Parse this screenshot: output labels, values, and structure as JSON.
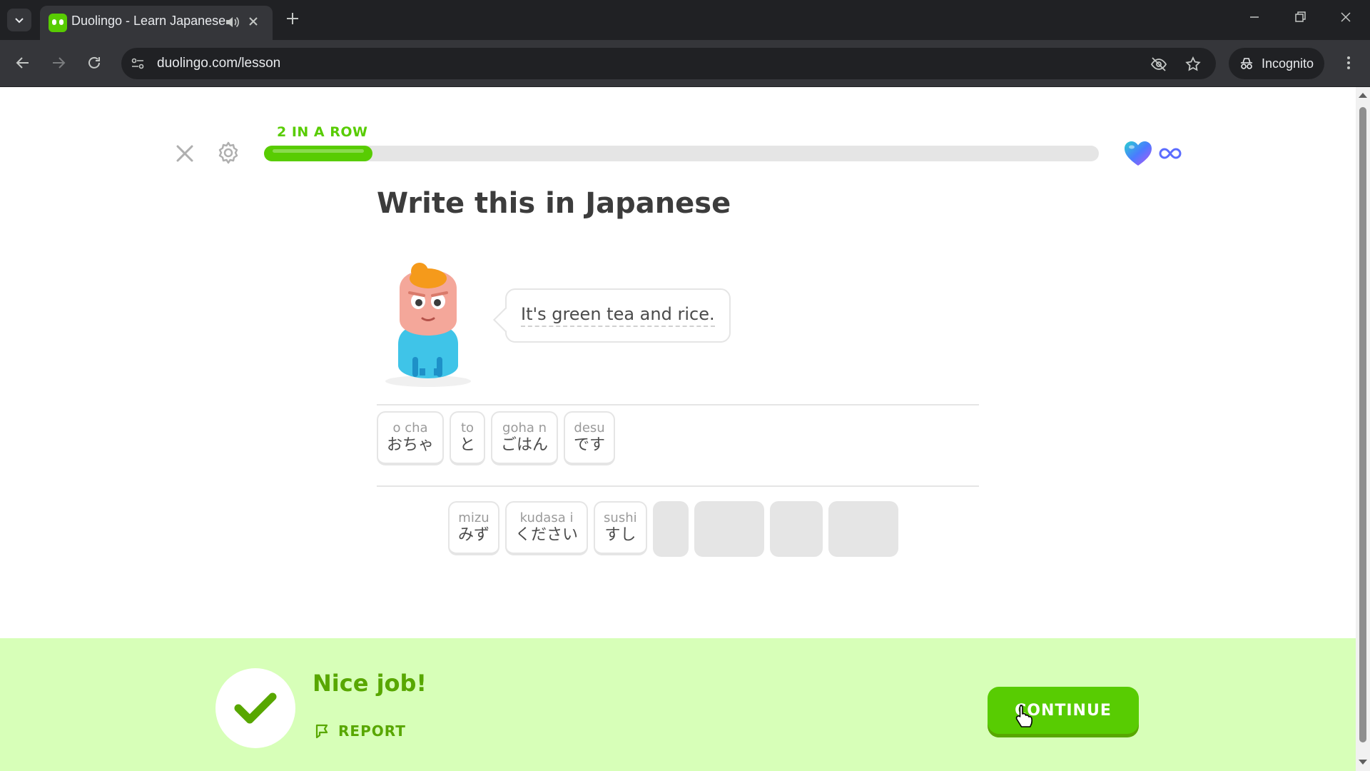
{
  "browser": {
    "tab_title": "Duolingo - Learn Japanese",
    "url": "duolingo.com/lesson",
    "incognito_label": "Incognito"
  },
  "lesson": {
    "streak_label": "2 IN A ROW",
    "progress": 0.13,
    "hearts": "∞",
    "prompt_title": "Write this in Japanese",
    "sentence": "It's green tea and rice.",
    "answer_tiles": [
      {
        "romaji": "o  cha",
        "kana": "おちゃ"
      },
      {
        "romaji": "to",
        "kana": "と"
      },
      {
        "romaji": "goha n",
        "kana": "ごはん"
      },
      {
        "romaji": "desu",
        "kana": "です"
      }
    ],
    "word_bank": [
      {
        "romaji": "mizu",
        "kana": "みず"
      },
      {
        "romaji": "kudasa i",
        "kana": "ください"
      },
      {
        "romaji": "sushi",
        "kana": "すし"
      }
    ]
  },
  "feedback": {
    "message": "Nice job!",
    "report_label": "REPORT",
    "continue_label": "CONTINUE"
  },
  "colors": {
    "brand_green": "#58cc02",
    "feedback_bg": "#d7ffb8",
    "feedback_text": "#58a700"
  },
  "icons": [
    "search-tabs-icon",
    "duolingo-owl-icon",
    "speaker-icon",
    "close-icon",
    "plus-icon",
    "back-icon",
    "forward-icon",
    "reload-icon",
    "site-info-icon",
    "eye-off-icon",
    "star-icon",
    "incognito-icon",
    "more-vert-icon",
    "gear-icon",
    "heart-icon",
    "infinity-icon",
    "checkmark-icon",
    "flag-icon",
    "cursor-icon"
  ]
}
